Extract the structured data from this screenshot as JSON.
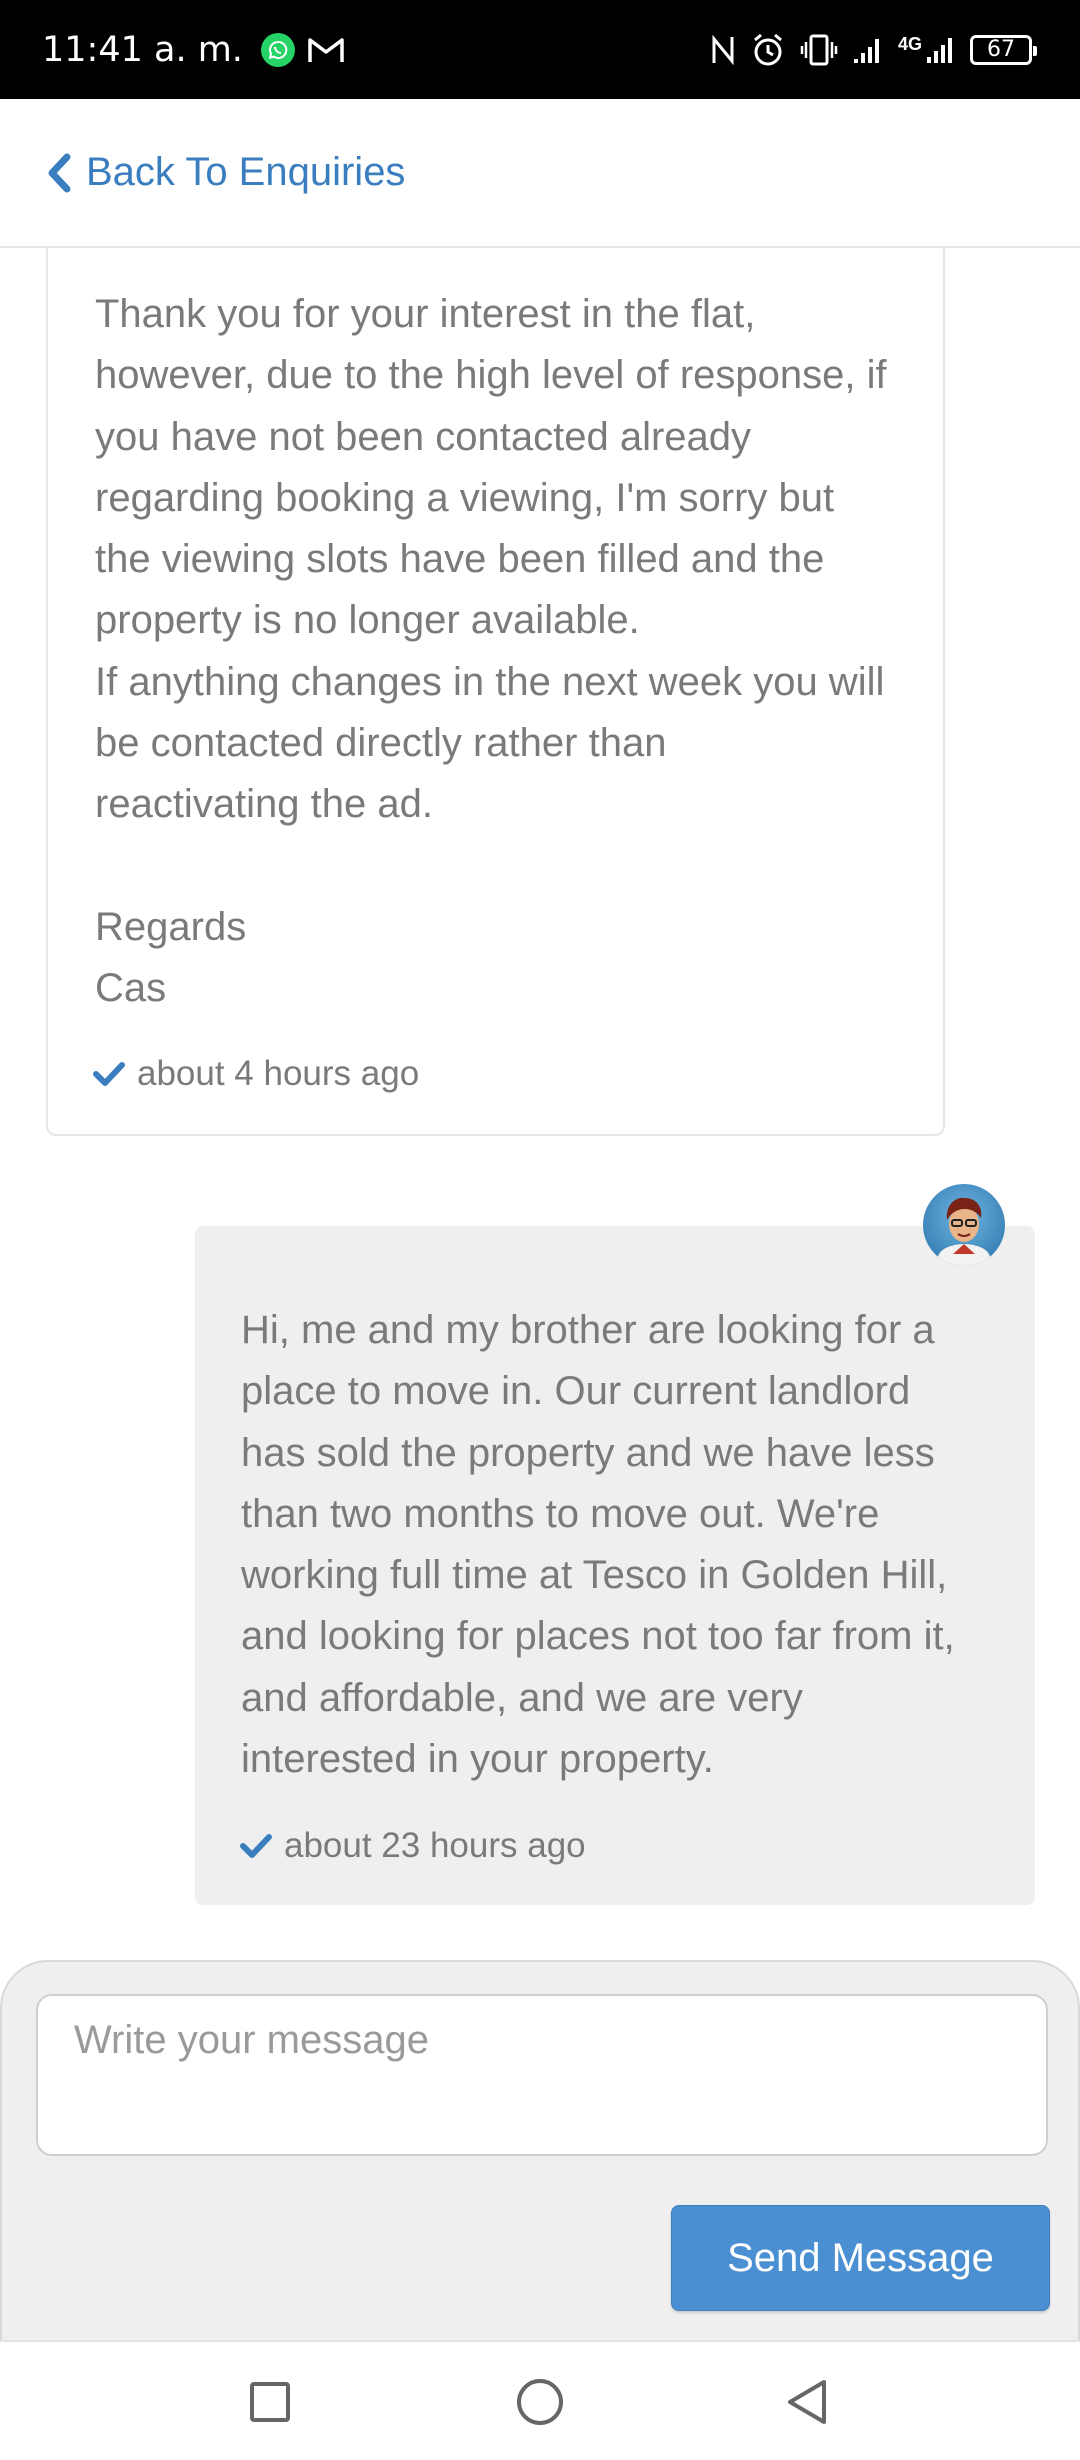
{
  "status_bar": {
    "time": "11:41 a. m.",
    "network": "4G",
    "battery": "67",
    "icons": [
      "whatsapp-icon",
      "gmail-icon",
      "nfc-icon",
      "alarm-icon",
      "vibrate-icon",
      "signal-icon",
      "4g-signal-icon",
      "battery-icon"
    ]
  },
  "header": {
    "back_label": "Back To Enquiries",
    "back_icon": "chevron-left-icon"
  },
  "messages": [
    {
      "direction": "received",
      "text": "Thank you for your interest in the flat,\nhowever, due to the high level of response, if\nyou have not been contacted already\nregarding booking a viewing, I'm sorry but\nthe viewing slots have been filled and the\nproperty is no longer available.\nIf anything changes in the next week you will\nbe contacted directly rather than\nreactivating the ad.\n\nRegards\nCas",
      "time": "about 4 hours ago",
      "status_icon": "check-icon"
    },
    {
      "direction": "sent",
      "text": "Hi, me and my brother are looking for a\nplace to move in. Our current landlord\nhas sold the property and we have less\nthan two months to move out. We're\nworking full time at Tesco in Golden Hill,\nand looking for places not too far from it,\nand affordable, and we are very\ninterested in your property.",
      "time": "about 23 hours ago",
      "status_icon": "check-icon",
      "avatar": "user-avatar"
    }
  ],
  "composer": {
    "placeholder": "Write your message",
    "value": "",
    "send_label": "Send Message"
  },
  "colors": {
    "accent": "#3a7ebf",
    "button": "#4a8fd1",
    "text": "#7a7a7a",
    "sent_bubble": "#efefef"
  },
  "nav": [
    "recents-square-icon",
    "home-circle-icon",
    "back-triangle-icon"
  ]
}
